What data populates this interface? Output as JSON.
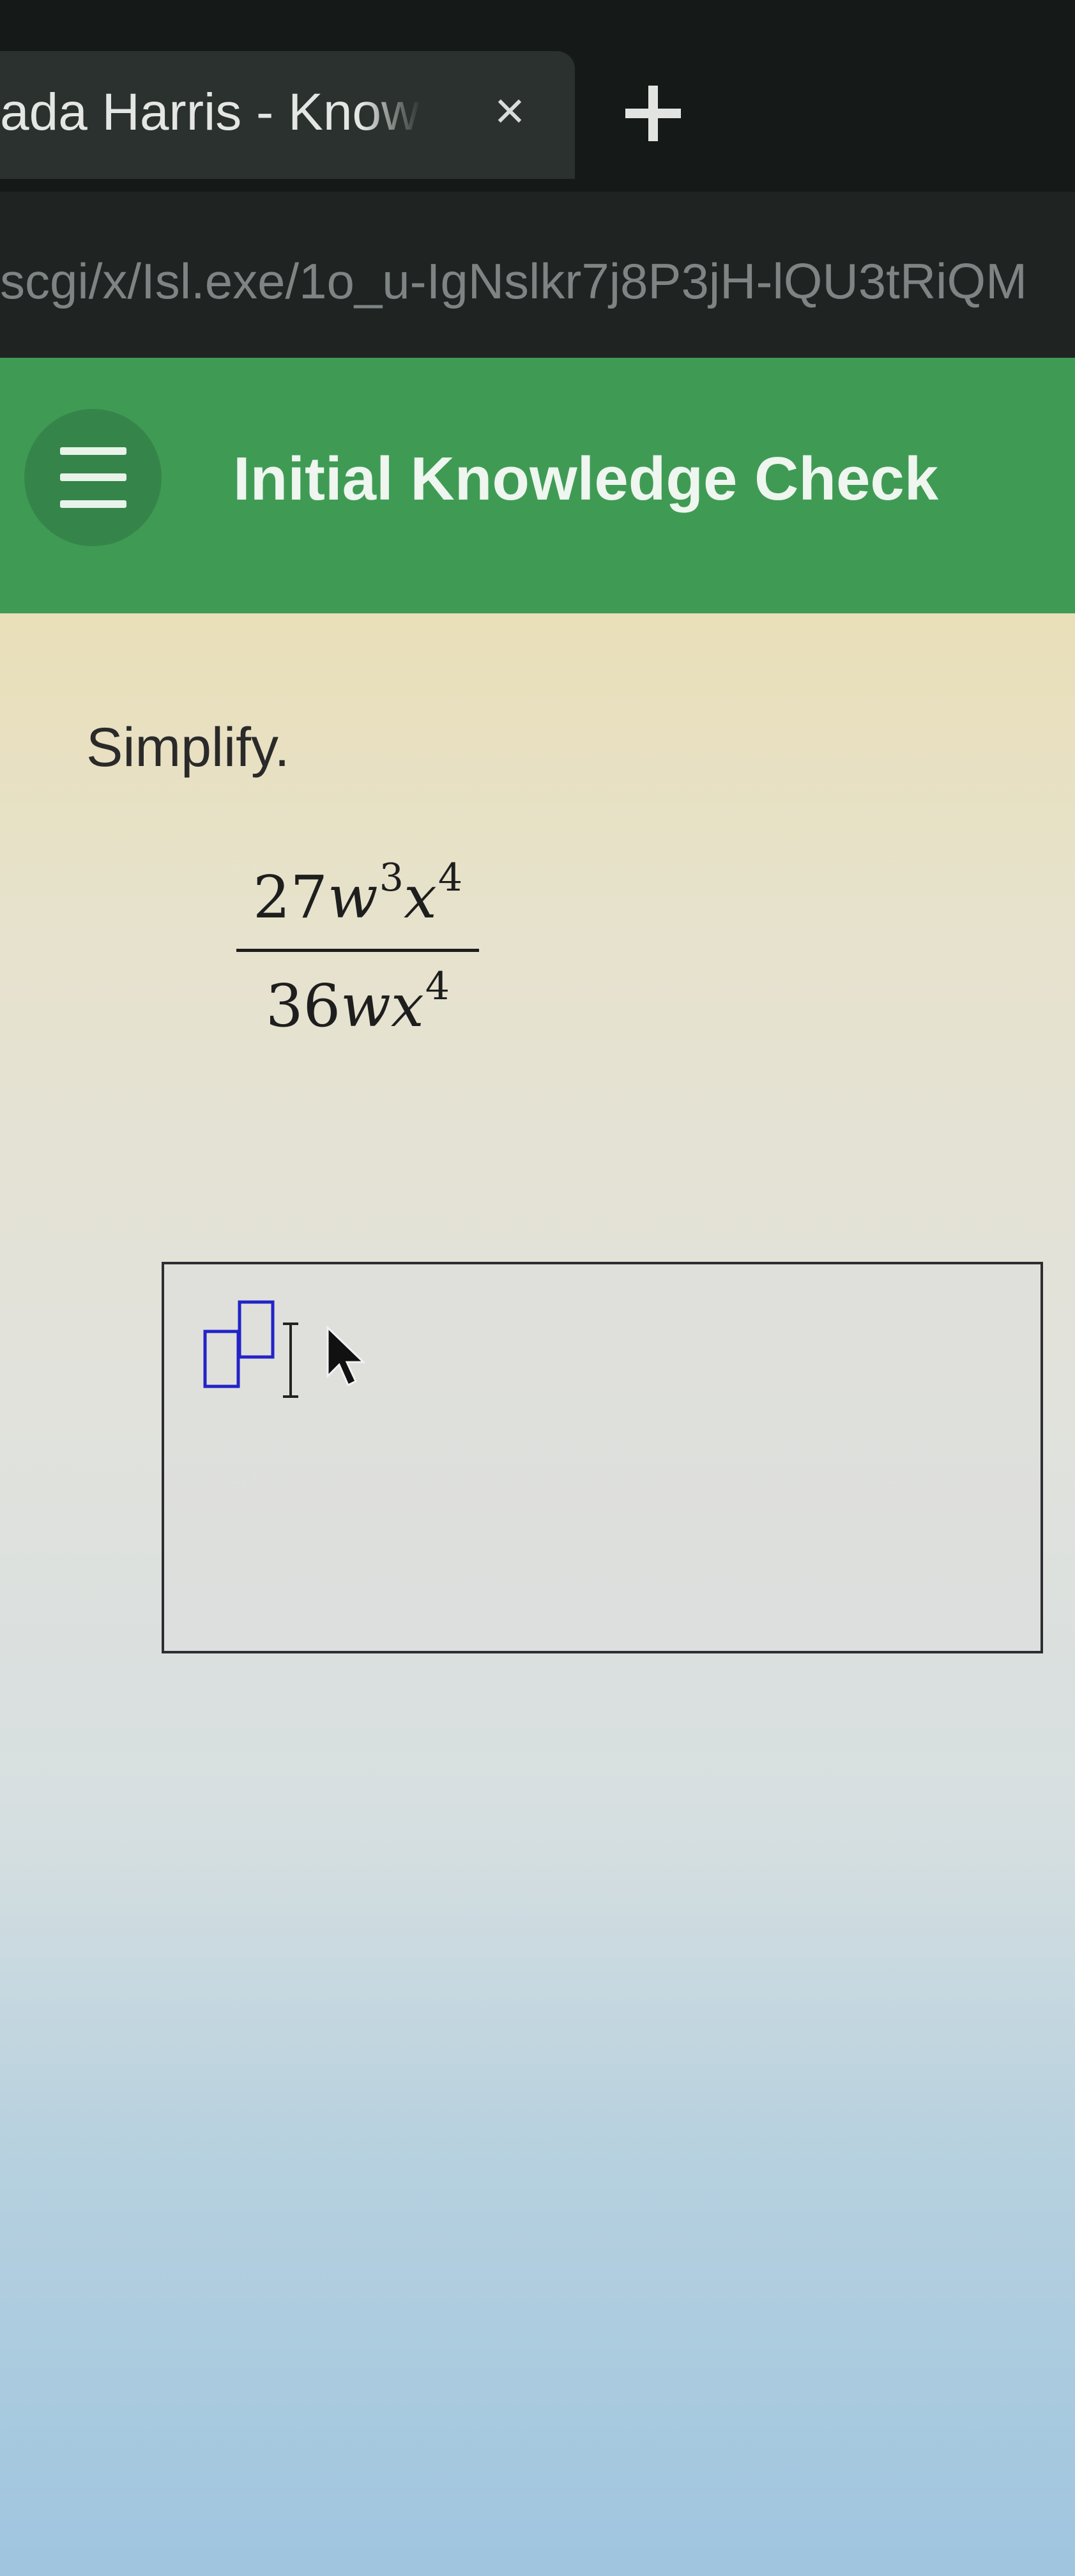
{
  "browser": {
    "tab": {
      "title": "ada Harris - Knowledge",
      "close_icon": "×"
    },
    "new_tab_icon": "plus-icon",
    "url": "scgi/x/Isl.exe/1o_u-IgNslkr7j8P3jH-lQU3tRiQM"
  },
  "header": {
    "menu_icon": "hamburger-menu-icon",
    "title": "Initial Knowledge Check",
    "color": "#3f9b54"
  },
  "question": {
    "instruction": "Simplify.",
    "fraction": {
      "numerator": {
        "coefficient": "27",
        "var1": "w",
        "exp1": "3",
        "var2": "x",
        "exp2": "4"
      },
      "denominator": {
        "coefficient": "36",
        "var1": "w",
        "var2": "x",
        "exp2": "4"
      }
    }
  },
  "answer": {
    "value": "",
    "tool_icon": "exponent-template-icon",
    "cursor_icon": "text-cursor-icon",
    "pointer_icon": "mouse-pointer-icon"
  }
}
